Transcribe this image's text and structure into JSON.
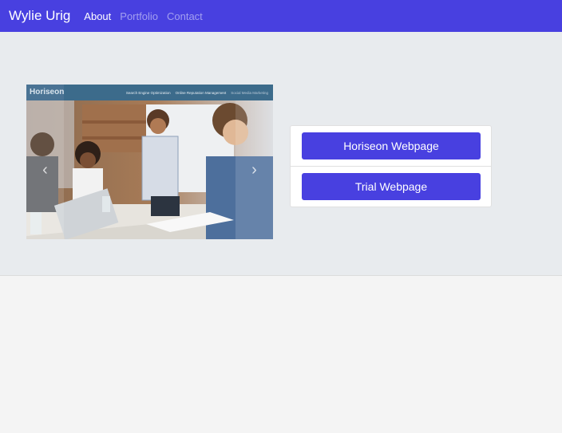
{
  "navbar": {
    "brand": "Wylie Urig",
    "links": [
      {
        "label": "About",
        "active": true
      },
      {
        "label": "Portfolio",
        "active": false
      },
      {
        "label": "Contact",
        "active": false
      }
    ]
  },
  "carousel": {
    "slide": {
      "logo": "Horiseon",
      "menu": [
        "Search Engine Optimization",
        "Online Reputation Management",
        "Social Media Marketing"
      ]
    },
    "prev_icon": "chevron-left-icon",
    "next_icon": "chevron-right-icon"
  },
  "links_card": {
    "buttons": [
      {
        "label": "Horiseon Webpage"
      },
      {
        "label": "Trial Webpage"
      }
    ]
  },
  "colors": {
    "primary": "#4840e0",
    "jumbotron_bg": "#e8ebee",
    "page_bg": "#f4f4f4"
  }
}
